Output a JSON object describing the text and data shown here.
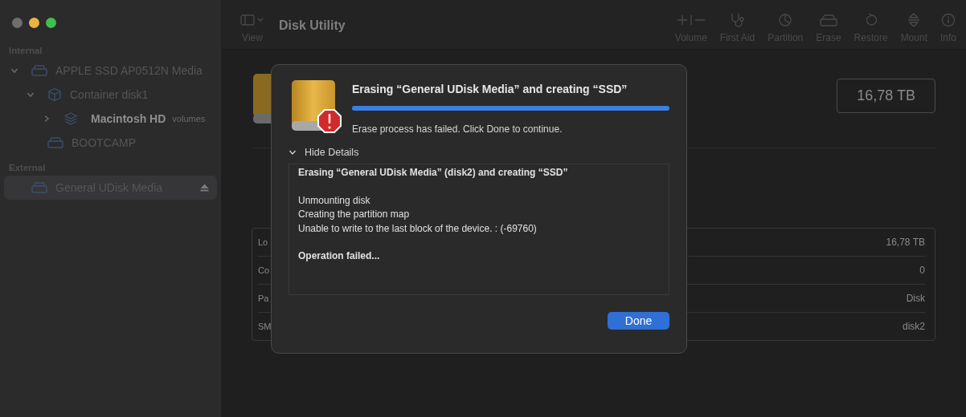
{
  "window": {
    "traffic_lights": [
      {
        "color": "#6e6e70"
      },
      {
        "color": "#e9b443"
      },
      {
        "color": "#3fbf4e"
      }
    ]
  },
  "toolbar": {
    "view_label": "View",
    "title": "Disk Utility",
    "actions": [
      {
        "kind": "volume",
        "label": "Volume"
      },
      {
        "kind": "first_aid",
        "label": "First Aid"
      },
      {
        "kind": "partition",
        "label": "Partition"
      },
      {
        "kind": "erase",
        "label": "Erase"
      },
      {
        "kind": "restore",
        "label": "Restore"
      },
      {
        "kind": "mount",
        "label": "Mount"
      },
      {
        "kind": "info",
        "label": "Info"
      }
    ]
  },
  "sidebar": {
    "sections": [
      {
        "title": "Internal",
        "items": [
          {
            "name": "APPLE SSD AP0512N Media",
            "kind": "disk",
            "expanded": true,
            "selected": false,
            "children": [
              {
                "name": "Container disk1",
                "kind": "container",
                "expanded": true,
                "selected": false,
                "children": [
                  {
                    "name": "Macintosh HD",
                    "badge": "volumes",
                    "kind": "volumes",
                    "expanded": false,
                    "selected": false
                  }
                ]
              },
              {
                "name": "BOOTCAMP",
                "kind": "disk",
                "selected": false
              }
            ]
          }
        ]
      },
      {
        "title": "External",
        "items": [
          {
            "name": "General UDisk Media",
            "kind": "disk",
            "selected": true,
            "ejectable": true
          }
        ]
      }
    ]
  },
  "content": {
    "capacity": "16,78 TB",
    "info_rows": [
      {
        "label": "Lo",
        "value": "16,78 TB"
      },
      {
        "label": "Co",
        "value": "0"
      },
      {
        "label": "Pa",
        "value": "Disk"
      },
      {
        "label": "SM",
        "value": "disk2"
      }
    ]
  },
  "dialog": {
    "title": "Erasing “General UDisk Media” and creating “SSD”",
    "progress": {
      "level": 1.0
    },
    "message": "Erase process has failed. Click Done to continue.",
    "details_toggle": {
      "label": "Hide Details",
      "expanded": true
    },
    "log": [
      {
        "kind": "heading",
        "text": "Erasing “General UDisk Media” (disk2) and creating “SSD”"
      },
      {
        "kind": "step",
        "text": "Unmounting disk"
      },
      {
        "kind": "step",
        "text": "Creating the partition map"
      },
      {
        "kind": "step",
        "text": "Unable to write to the last block of the device. : (-69760)"
      },
      {
        "kind": "result",
        "text": "Operation failed..."
      }
    ],
    "button": "Done"
  }
}
